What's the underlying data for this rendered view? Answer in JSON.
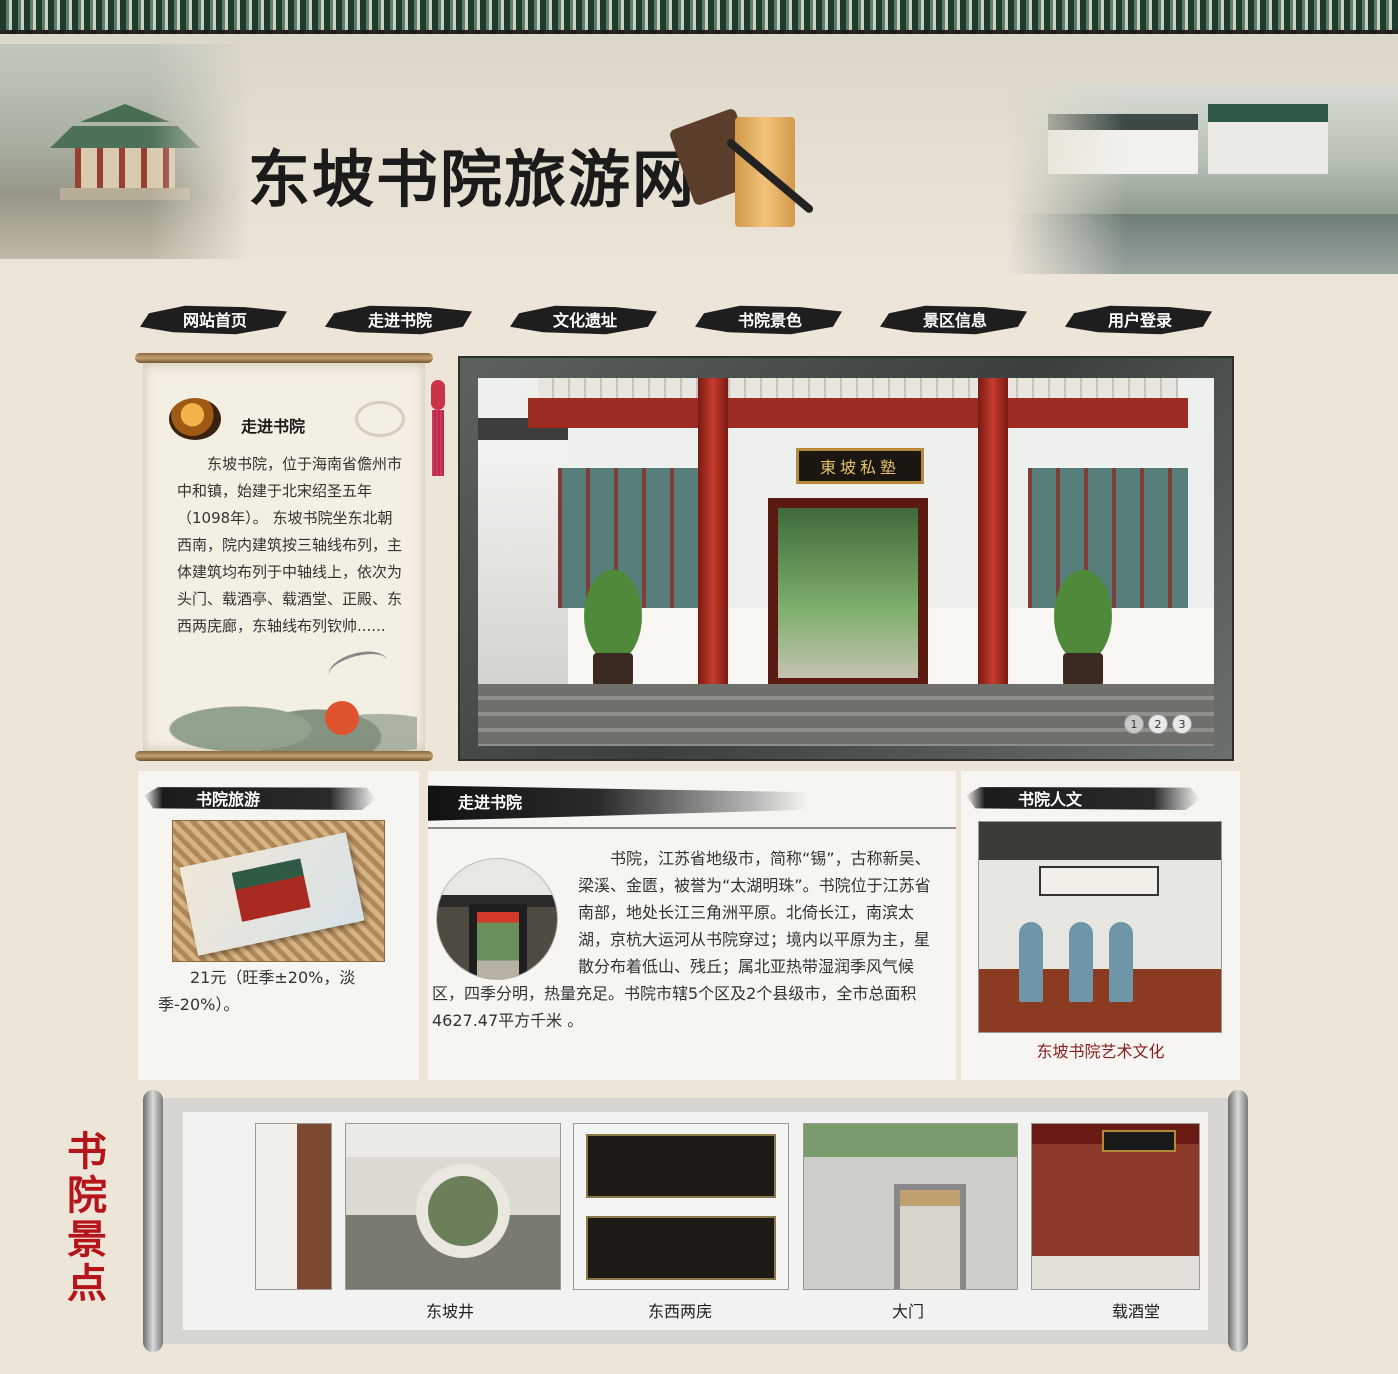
{
  "header": {
    "site_title": "东坡书院旅游网"
  },
  "nav": {
    "items": [
      {
        "label": "网站首页"
      },
      {
        "label": "走进书院"
      },
      {
        "label": "文化遗址"
      },
      {
        "label": "书院景色"
      },
      {
        "label": "景区信息"
      },
      {
        "label": "用户登录"
      }
    ]
  },
  "intro": {
    "title": "走进书院",
    "text": "东坡书院，位于海南省儋州市中和镇，始建于北宋绍圣五年（1098年）。 东坡书院坐东北朝西南，院内建筑按三轴线布列，主体建筑均布列于中轴线上，依次为头门、载酒亭、载酒堂、正殿、东西两庑廊，东轴线布列钦帅......"
  },
  "slider": {
    "plaque_text": "東坡私塾",
    "dots": [
      "1",
      "2",
      "3"
    ],
    "active": 1
  },
  "tour": {
    "title": "书院旅游",
    "price_text": "21元（旺季±20%，淡季-20%）。"
  },
  "about": {
    "title": "走进书院",
    "text": "书院，江苏省地级市，简称“锡”，古称新吴、梁溪、金匮，被誉为“太湖明珠”。书院位于江苏省南部，地处长江三角洲平原。北倚长江，南滨太湖，京杭大运河从书院穿过；境内以平原为主，星散分布着低山、残丘；属北亚热带湿润季风气候区，四季分明，热量充足。书院市辖5个区及2个县级市，全市总面积4627.47平方千米 。"
  },
  "culture": {
    "title": "书院人文",
    "caption": "东坡书院艺术文化"
  },
  "scenery": {
    "title": "书院景点",
    "captions": [
      "东坡井",
      "东西两庑",
      "大门",
      "载酒堂"
    ]
  },
  "colors": {
    "background": "#ece5d8",
    "title_red": "#b5141a",
    "caption_red": "#8a1e1e"
  }
}
